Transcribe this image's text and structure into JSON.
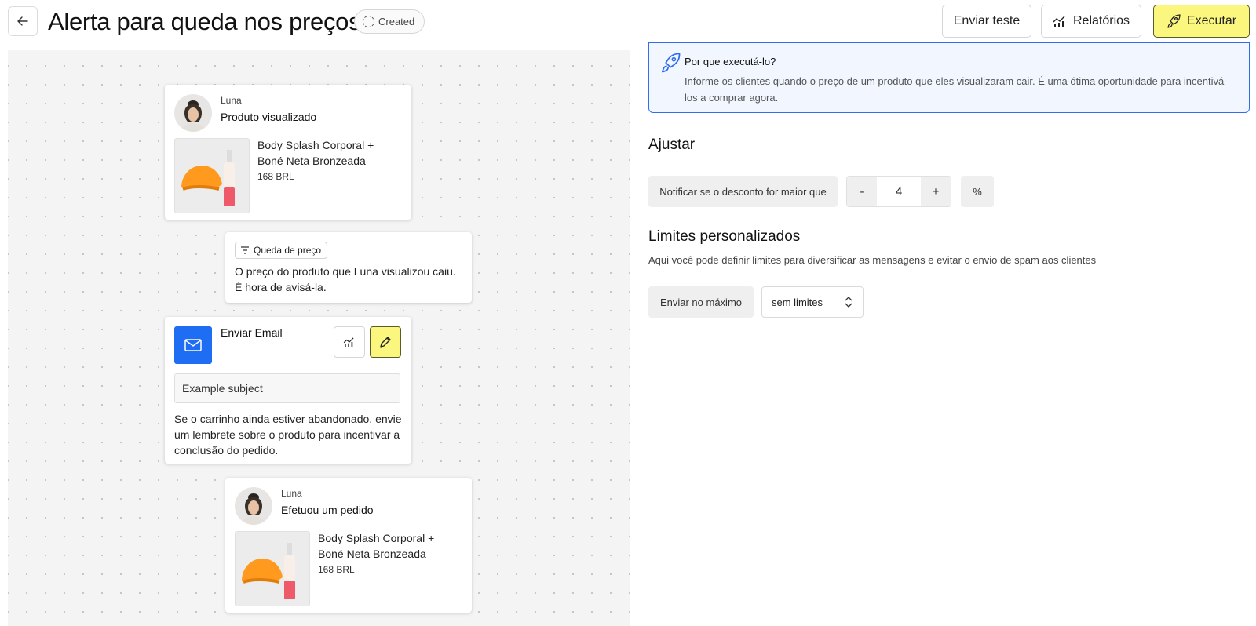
{
  "header": {
    "title": "Alerta para queda nos preços",
    "status": "Created",
    "buttons": {
      "test": "Enviar teste",
      "reports": "Relatórios",
      "run": "Executar"
    }
  },
  "flow": {
    "trigger": {
      "user": "Luna",
      "event": "Produto visualizado",
      "product_name": "Body Splash Corporal + Boné Neta Bronzeada",
      "product_price": "168 BRL"
    },
    "condition": {
      "chip": "Queda de preço",
      "text": "O preço do produto que Luna visualizou caiu. É hora de avisá-la."
    },
    "email": {
      "title": "Enviar Email",
      "subject": "Example subject",
      "description": "Se o carrinho ainda estiver abandonado, envie um lembrete sobre o produto para incentivar a conclusão do pedido."
    },
    "goal": {
      "user": "Luna",
      "event": "Efetuou um pedido",
      "product_name": "Body Splash Corporal + Boné Neta Bronzeada",
      "product_price": "168 BRL"
    }
  },
  "panel": {
    "info": {
      "title": "Por que executá-lo?",
      "text": "Informe os clientes quando o preço de um produto que eles visualizaram cair. É uma ótima oportunidade para incentivá-los a comprar agora."
    },
    "adjust": {
      "title": "Ajustar",
      "label": "Notificar se o desconto for maior que",
      "minus": "-",
      "value": "4",
      "plus": "+",
      "unit": "%"
    },
    "limits": {
      "title": "Limites personalizados",
      "subtitle": "Aqui você pode definir limites para diversificar as mensagens e evitar o envio de spam aos clientes",
      "label": "Enviar no máximo",
      "selected": "sem limites"
    }
  },
  "colors": {
    "accent_yellow": "#fbf77e",
    "email_blue": "#1f6df2",
    "info_border": "#2f6df0"
  }
}
